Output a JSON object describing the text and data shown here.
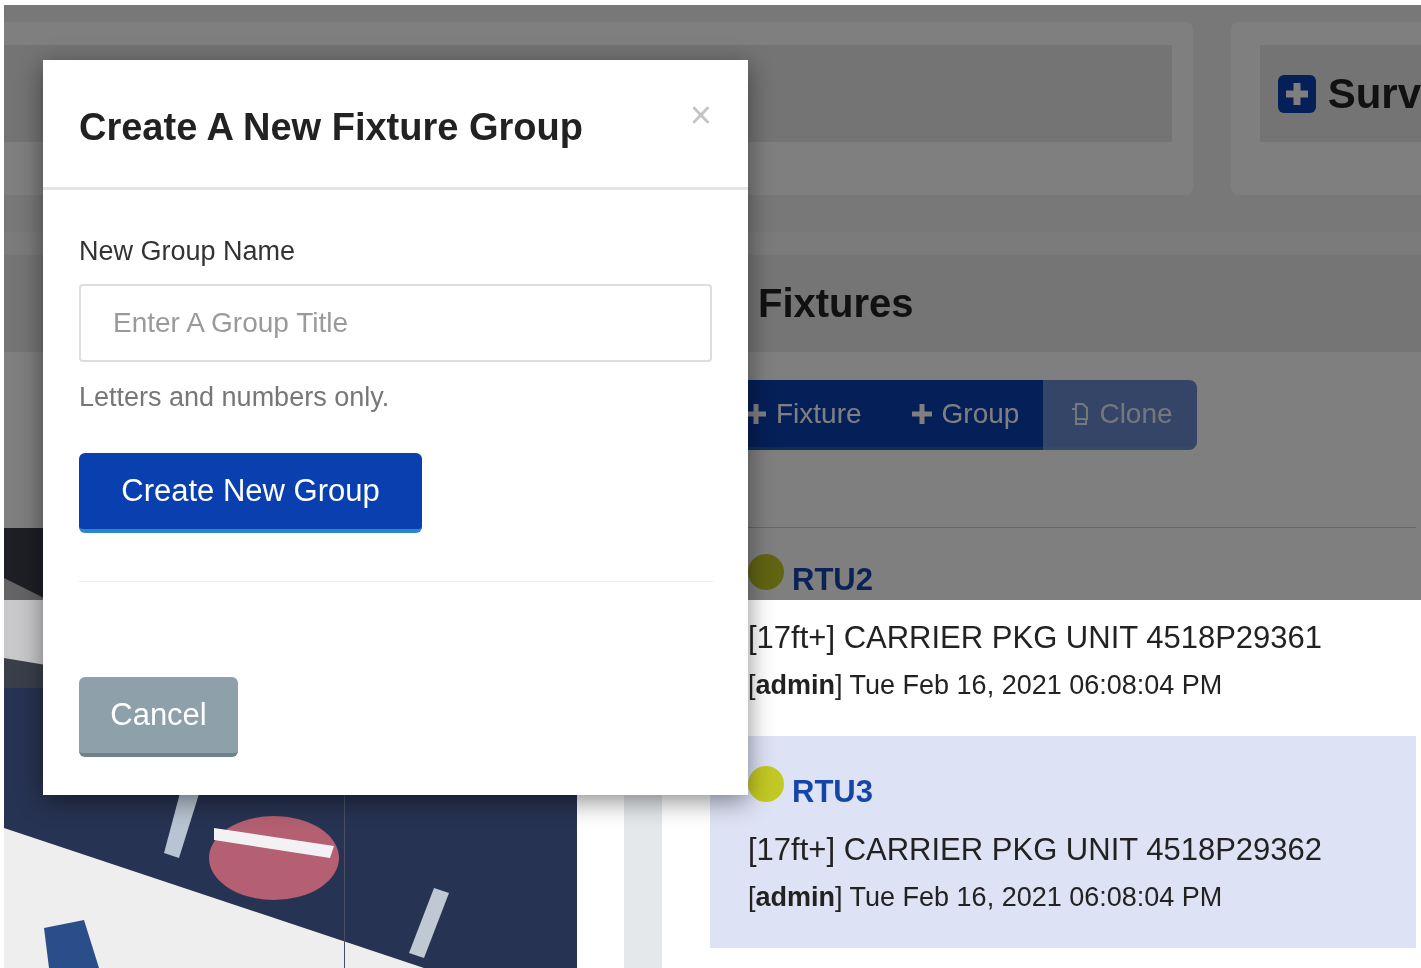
{
  "top_button": {
    "label": "Surv"
  },
  "panel": {
    "title": "Fixtures",
    "toolbar": [
      {
        "kind": "add",
        "label": "Fixture",
        "disabled": false
      },
      {
        "kind": "add",
        "label": "Group",
        "disabled": false
      },
      {
        "kind": "clone",
        "label": "Clone",
        "disabled": true
      }
    ],
    "fixtures": [
      {
        "name": "RTU2",
        "description": "[17ft+] CARRIER PKG UNIT 4518P29361",
        "meta": "[**admin**] Tue Feb 16, 2021 06:08:04 PM",
        "selected": false
      },
      {
        "name": "RTU3",
        "description": "[17ft+] CARRIER PKG UNIT 4518P29362",
        "meta": "[**admin**] Tue Feb 16, 2021 06:08:04 PM",
        "selected": true
      }
    ]
  },
  "modal": {
    "title": "Create A New Fixture Group",
    "close": "×",
    "field_label": "New Group Name",
    "placeholder": "Enter A Group Title",
    "help": "Letters and numbers only.",
    "submit": "Create New Group",
    "cancel": "Cancel"
  }
}
